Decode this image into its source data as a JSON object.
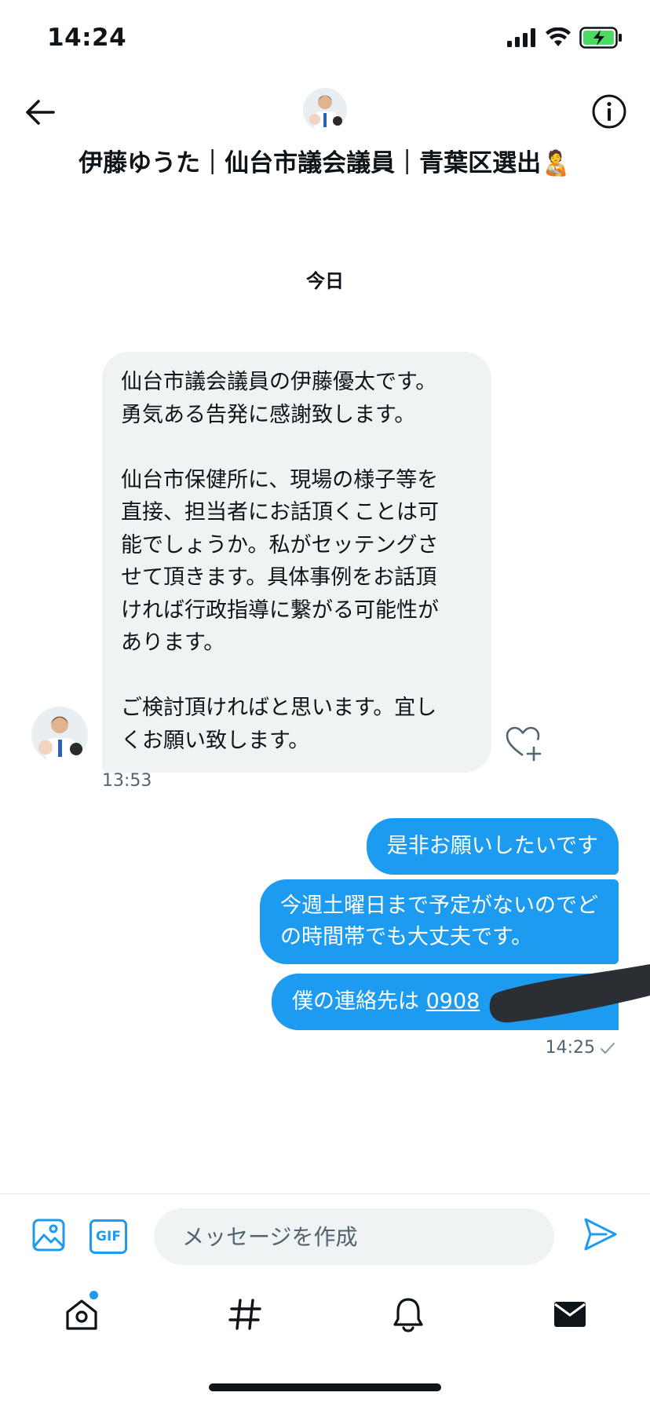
{
  "status_bar": {
    "time": "14:24"
  },
  "header": {
    "contact_name": "伊藤ゆうた｜仙台市議会議員｜青葉区選出🧑‍🍼",
    "back_icon": "arrow-left-icon",
    "info_icon": "info-icon"
  },
  "conversation": {
    "date_divider": "今日",
    "incoming": {
      "lines": [
        "仙台市議会議員の伊藤優太です。",
        "勇気ある告発に感謝致します。",
        "",
        "仙台市保健所に、現場の様子等を",
        "直接、担当者にお話頂くことは可",
        "能でしょうか。私がセッテングさ",
        "せて頂きます。具体事例をお話頂",
        "ければ行政指導に繋がる可能性が",
        "あります。",
        "",
        "ご検討頂ければと思います。宜し",
        "くお願い致します。"
      ],
      "time": "13:53"
    },
    "outgoing": {
      "message_1": "是非お願いしたいです",
      "message_2_line_1": "今週土曜日まで予定がないのでど",
      "message_2_line_2": "の時間帯でも大丈夫です。",
      "message_3_text": "僕の連絡先は",
      "message_3_phone": "0908",
      "time": "14:25"
    }
  },
  "composer": {
    "placeholder": "メッセージを作成",
    "gif_label": "GIF"
  },
  "colors": {
    "accent": "#1d9bf0",
    "incoming_bubble": "#eff3f4",
    "text_primary": "#0f1419",
    "text_secondary": "#536471"
  }
}
